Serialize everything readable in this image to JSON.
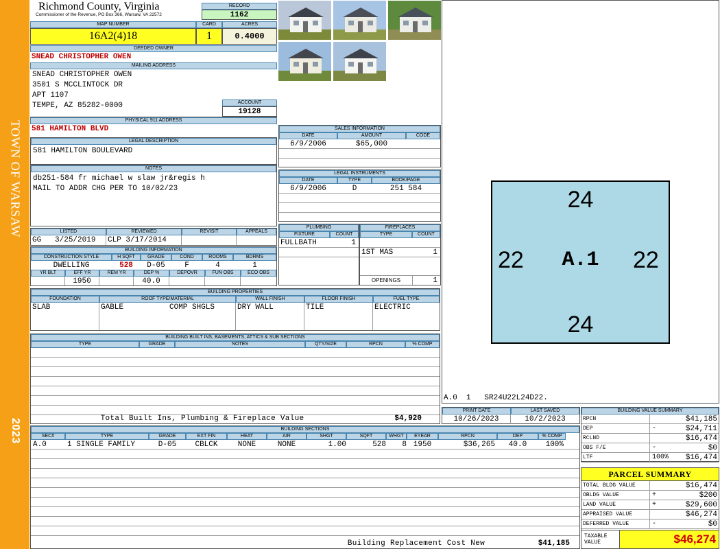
{
  "side": {
    "town": "TOWN OF WARSAW",
    "year": "2023"
  },
  "header": {
    "county": "Richmond County, Virginia",
    "address": "Commissioner of the Revenue, PO Box 366, Warsaw, VA 22572",
    "record_label": "RECORD",
    "record": "1162"
  },
  "map": {
    "map_label": "MAP NUMBER",
    "map_number": "16A2(4)18",
    "card_label": "CARD",
    "card": "1",
    "acres_label": "ACRES",
    "acres": "0.4000"
  },
  "owner": {
    "label": "DEEDED OWNER",
    "name": "SNEAD CHRISTOPHER OWEN"
  },
  "mailing": {
    "label": "MAILING ADDRESS",
    "line1": "SNEAD CHRISTOPHER OWEN",
    "line2": "3501 S MCCLINTOCK DR",
    "line3": "APT 1107",
    "line4": "TEMPE, AZ 85282-0000"
  },
  "account": {
    "label": "ACCOUNT",
    "value": "19128"
  },
  "physical": {
    "label": "PHYSICAL 911 ADDRESS",
    "value": "581 HAMILTON BLVD"
  },
  "legal": {
    "label": "LEGAL DESCRIPTION",
    "value": "581 HAMILTON BOULEVARD"
  },
  "notes": {
    "label": "NOTES",
    "line1": "db251-584 fr michael w slaw jr&regis h",
    "line2": "MAIL TO ADDR CHG PER TO 10/02/23"
  },
  "sales": {
    "label": "SALES INFORMATION",
    "h_date": "DATE",
    "h_amount": "AMOUNT",
    "h_code": "CODE",
    "date": "6/9/2006",
    "amount": "$65,000",
    "code": ""
  },
  "legal_instr": {
    "label": "LEGAL INSTRUMENTS",
    "h_date": "DATE",
    "h_type": "TYPE",
    "h_book": "BOOK/PAGE",
    "date": "6/9/2006",
    "type": "D",
    "book": "251 584"
  },
  "plumbing": {
    "label": "PLUMBING",
    "h_fixture": "FIXTURE",
    "h_count": "COUNT",
    "fixture": "FULLBATH",
    "count": "1"
  },
  "fireplaces": {
    "label": "FIREPLACES",
    "h_type": "TYPE",
    "h_count": "COUNT",
    "type": "1ST MAS",
    "count": "1",
    "openings_label": "OPENINGS",
    "openings": "1"
  },
  "listed": {
    "listed_label": "LISTED",
    "listed_by": "GG",
    "listed_date": "3/25/2019",
    "reviewed_label": "REVIEWED",
    "reviewed_by": "CLP",
    "reviewed_date": "3/17/2014",
    "revisit_label": "REVISIT",
    "appeals_label": "APPEALS"
  },
  "building_info": {
    "label": "BUILDING INFORMATION",
    "h_const": "CONSTRUCTION STYLE",
    "h_hsqft": "H SQFT",
    "h_grade": "GRADE",
    "h_cond": "COND",
    "h_rooms": "ROOMS",
    "h_bdrms": "BDRMS",
    "const": "DWELLING",
    "hsqft": "528",
    "grade": "D-05",
    "cond": "F",
    "rooms": "4",
    "bdrms": "1",
    "h_yrblt": "YR BLT",
    "h_effyr": "EFF YR",
    "h_remyr": "REM YR",
    "h_dep": "DEP %",
    "h_depovr": "DEPOVR",
    "h_funobs": "FUN OBS",
    "h_ecoobs": "ECO OBS",
    "effyr": "1950",
    "dep": "40.0"
  },
  "properties": {
    "label": "BUILDING PROPERTIES",
    "h_found": "FOUNDATION",
    "h_roof": "ROOF TYPE/MATERIAL",
    "h_wall": "WALL FINISH",
    "h_floor": "FLOOR FINISH",
    "h_fuel": "FUEL TYPE",
    "found": "SLAB",
    "roof_type": "GABLE",
    "roof_mat": "COMP SHGLS",
    "wall": "DRY WALL",
    "floor": "TILE",
    "fuel": "ELECTRIC"
  },
  "builtins": {
    "label": "BUILDING BUILT INS, BASEMENTS, ATTICS & SUB SECTIONS",
    "h_type": "TYPE",
    "h_grade": "GRADE",
    "h_notes": "NOTES",
    "h_qty": "QTY/SIZE",
    "h_rpcn": "RPCN",
    "h_comp": "% COMP",
    "total_label": "Total Built Ins, Plumbing & Fireplace Value",
    "total_value": "$4,920"
  },
  "sketch": {
    "top": "24",
    "bottom": "24",
    "left": "22",
    "right": "22",
    "center": "A.1",
    "code": "A.0  1   SR24U22L24D22."
  },
  "dates": {
    "print_label": "PRINT DATE",
    "print_date": "10/26/2023",
    "saved_label": "LAST SAVED",
    "saved_date": "10/2/2023"
  },
  "sections": {
    "label": "BUILDING SECTIONS",
    "headers": [
      "SEC#",
      "TYPE",
      "GRADE",
      "EXT FIN",
      "HEAT",
      "AIR",
      "SHGT",
      "SQFT",
      "WHGT",
      "EYEAR",
      "RPCN",
      "DEP",
      "% COMP"
    ],
    "row": [
      "A.0",
      "1 SINGLE FAMILY",
      "D-05",
      "CBLCK",
      "NONE",
      "NONE",
      "1.00",
      "528",
      "8",
      "1950",
      "$36,265",
      "40.0",
      "100%"
    ],
    "replacement_label": "Building Replacement Cost New",
    "replacement_value": "$41,185"
  },
  "value_summary": {
    "label": "BUILDING VALUE SUMMARY",
    "rows": [
      [
        "RPCN",
        "",
        "$41,185"
      ],
      [
        "DEP",
        "-",
        "$24,711"
      ],
      [
        "RCLND",
        "",
        "$16,474"
      ],
      [
        "OBS F/E",
        "-",
        "$0"
      ],
      [
        "LTF",
        "100%",
        "$16,474"
      ]
    ]
  },
  "parcel": {
    "label": "PARCEL SUMMARY",
    "rows": [
      [
        "TOTAL BLDG VALUE",
        "",
        "$16,474"
      ],
      [
        "OBLDG VALUE",
        "+",
        "$200"
      ],
      [
        "LAND VALUE",
        "+",
        "$29,600"
      ],
      [
        "APPRAISED VALUE",
        "",
        "$46,274"
      ],
      [
        "DEFERRED VALUE",
        "-",
        "$0"
      ]
    ],
    "taxable_label1": "TAXABLE",
    "taxable_label2": "VALUE",
    "taxable_value": "$46,274"
  },
  "photos": [
    {
      "sky": "#b9c7d8",
      "grass": "#7c8a3a",
      "house": "#f3f3ef",
      "roof": "#3c4048"
    },
    {
      "sky": "#a7c4e4",
      "grass": "#8e9a4a",
      "house": "#ecebe3",
      "roof": "#4a4e58"
    },
    {
      "sky": "#5d8a3c",
      "grass": "#8f8c54",
      "house": "#ededea",
      "roof": "#48505a"
    },
    {
      "sky": "#9cbcde",
      "grass": "#6f8a3a",
      "house": "#efece0",
      "roof": "#44464e"
    },
    {
      "sky": "#a8c2de",
      "grass": "#7e8845",
      "house": "#f5f5f2",
      "roof": "#3e424a"
    }
  ]
}
